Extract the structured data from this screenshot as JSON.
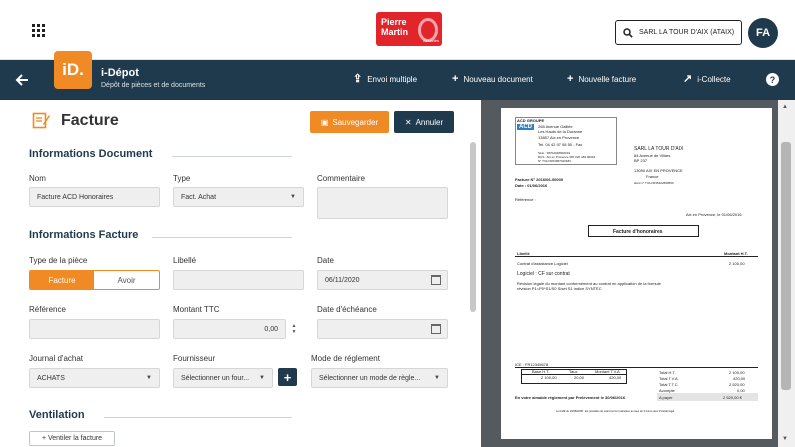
{
  "topbar": {
    "logo_line1": "Pierre",
    "logo_line2": "Martin",
    "logo_sub": "Associés",
    "company": "SARL LA TOUR D'AIX (ATAIX)",
    "avatar": "FA"
  },
  "nav": {
    "app_icon": "iD.",
    "app_title": "i-Dépot",
    "app_subtitle": "Dépôt de pièces et de documents",
    "actions": {
      "envoi": "Envoi multiple",
      "nouveau_doc": "Nouveau document",
      "nouvelle_facture": "Nouvelle facture",
      "collecte": "i-Collecte"
    },
    "help": "?"
  },
  "form": {
    "title": "Facture",
    "save": "Sauvegarder",
    "cancel": "Annuler",
    "section_doc": "Informations Document",
    "nom_label": "Nom",
    "nom_value": "Facture ACD Honoraires",
    "type_label": "Type",
    "type_value": "Fact. Achat",
    "commentaire_label": "Commentaire",
    "section_facture": "Informations Facture",
    "type_piece_label": "Type de la pièce",
    "toggle_facture": "Facture",
    "toggle_avoir": "Avoir",
    "libelle_label": "Libellé",
    "date_label": "Date",
    "date_value": "06/11/2020",
    "reference_label": "Référence",
    "montant_label": "Montant TTC",
    "montant_value": "0,00",
    "echeance_label": "Date d'échéance",
    "journal_label": "Journal d'achat",
    "journal_value": "ACHATS",
    "fournisseur_label": "Fournisseur",
    "fournisseur_value": "Sélectionner un four...",
    "reglement_label": "Mode de réglement",
    "reglement_value": "Sélectionner un mode de règle...",
    "section_ventilation": "Ventilation",
    "ventiler_button": "+ Ventiler la facture"
  },
  "preview": {
    "group": "ACD GROUPE",
    "logo": "ACD",
    "addr1": "268 Avenue Galilée",
    "addr2": "Les Hauts de la Duranne",
    "addr3": "13857 Aix en Provence",
    "tel": "Tel.  04 42 97 08 50   -  Fax",
    "siret1": "Siret : 38702048900019",
    "siret2": "RCS : Aix en Provence 387 020 483 00019",
    "tva": "N° TVA FR63387020483",
    "client": "SARL LA TOUR D'AIX",
    "client_addr1": "84 Avenue de Villars",
    "client_addr2": "BP 237",
    "client_city": "13090 AIX EN PROVENCE",
    "client_country": "France",
    "client_tva": "ident n° TVA FR35402658559",
    "facture_no": "Facture N° 2016/06-00000",
    "facture_date": "Date : 01/06/2016",
    "reference": "Référence :",
    "place_date": "Aix en Provence, le 01/06/2016",
    "box_title": "Facture d'honoraires",
    "col_libelle": "Libellé",
    "col_montant": "Montant H.T.",
    "line1": "Contrat d'assistance Logiciel",
    "line1_amount": "2 100,00",
    "line2": "Logiciel : CF sur contrat",
    "line3": "Révision légale du montant conformément au contrat en application de la formule",
    "line4": "révision P1=P0*S1/S0          S/set S1 indice SYNTEC",
    "ice": "ICE : FR12345678",
    "tbl_h1": "Base H.T.",
    "tbl_h2": "Taux",
    "tbl_h3": "Montant T.V.A.",
    "tbl_v1": "2 100,00",
    "tbl_v2": "20,00",
    "tbl_v3": "420,00",
    "tot_ht_label": "Total H.T.",
    "tot_ht": "2 100,00",
    "tot_tva_label": "Total T.V.A.",
    "tot_tva": "420,00",
    "tot_ttc_label": "Total T.T.C.",
    "tot_ttc": "2 520,00",
    "acompte_label": "Acompte",
    "acompte": "0,00",
    "apayer_label": "A payer",
    "apayer": "2 520,00  €",
    "payment_note": "En votre aimable règlement par Prélèvement le 30/06/2016",
    "footer": "Loi LME du 04/08/2008 : les pénalités de retard seront calculées au taux de 3 fois le taux d'intérêt légal"
  }
}
